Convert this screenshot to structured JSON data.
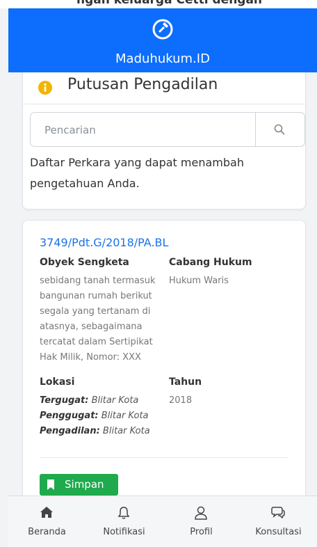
{
  "top_clip_text": "ngan keluarga Cetti dengan mengacu",
  "app": {
    "brand": "Maduhukum.ID"
  },
  "search_card": {
    "title": "Putusan Pengadilan",
    "search_placeholder": "Pencarian",
    "description": "Daftar Perkara yang dapat menambah pengetahuan Anda."
  },
  "case": {
    "number": "3749/Pdt.G/2018/PA.BL",
    "obyek_label": "Obyek Sengketa",
    "obyek_lines": [
      "sebidang tanah termasuk",
      "bangunan rumah berikut",
      "segala yang tertanam di",
      "atasnya, sebagaimana",
      "tercatat dalam Sertipikat",
      "Hak Milik, Nomor: XXX"
    ],
    "cabang_label": "Cabang Hukum",
    "cabang_value": "Hukum Waris",
    "lokasi_label": "Lokasi",
    "tergugat_label": "Tergugat:",
    "tergugat_value": "Blitar Kota",
    "penggugat_label": "Penggugat:",
    "penggugat_value": "Blitar Kota",
    "pengadilan_label": "Pengadilan:",
    "pengadilan_value": "Blitar Kota",
    "tahun_label": "Tahun",
    "tahun_value": "2018",
    "save_label": "Simpan"
  },
  "bottom_nav": [
    {
      "label": "Beranda",
      "icon": "home-icon"
    },
    {
      "label": "Notifikasi",
      "icon": "bell-icon"
    },
    {
      "label": "Profil",
      "icon": "user-icon"
    },
    {
      "label": "Konsultasi",
      "icon": "chat-icon"
    }
  ],
  "colors": {
    "primary": "#0d6efd",
    "link": "#1a73e8",
    "save": "#1faa4d",
    "info_icon": "#f4b400"
  }
}
